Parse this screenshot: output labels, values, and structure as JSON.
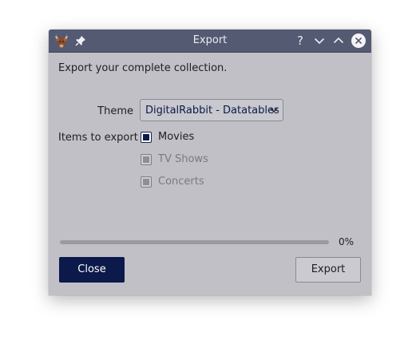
{
  "window": {
    "title": "Export"
  },
  "intro_text": "Export your complete collection.",
  "theme": {
    "label": "Theme",
    "selected": "DigitalRabbit - Datatables"
  },
  "items": {
    "label": "Items to export",
    "options": [
      {
        "label": "Movies",
        "checked": true,
        "enabled": true
      },
      {
        "label": "TV Shows",
        "checked": false,
        "enabled": false
      },
      {
        "label": "Concerts",
        "checked": false,
        "enabled": false
      }
    ]
  },
  "progress": {
    "value": 0,
    "text": "0%"
  },
  "buttons": {
    "close_label": "Close",
    "export_label": "Export"
  },
  "icons": {
    "app": "deer-head-icon",
    "pin": "pin-icon",
    "help": "help-icon",
    "minimize": "chevron-down-icon",
    "maximize": "chevron-up-icon",
    "close": "close-icon"
  },
  "colors": {
    "titlebar": "#545a72",
    "window_bg": "#c0c0c6",
    "accent": "#0b1a4a"
  }
}
